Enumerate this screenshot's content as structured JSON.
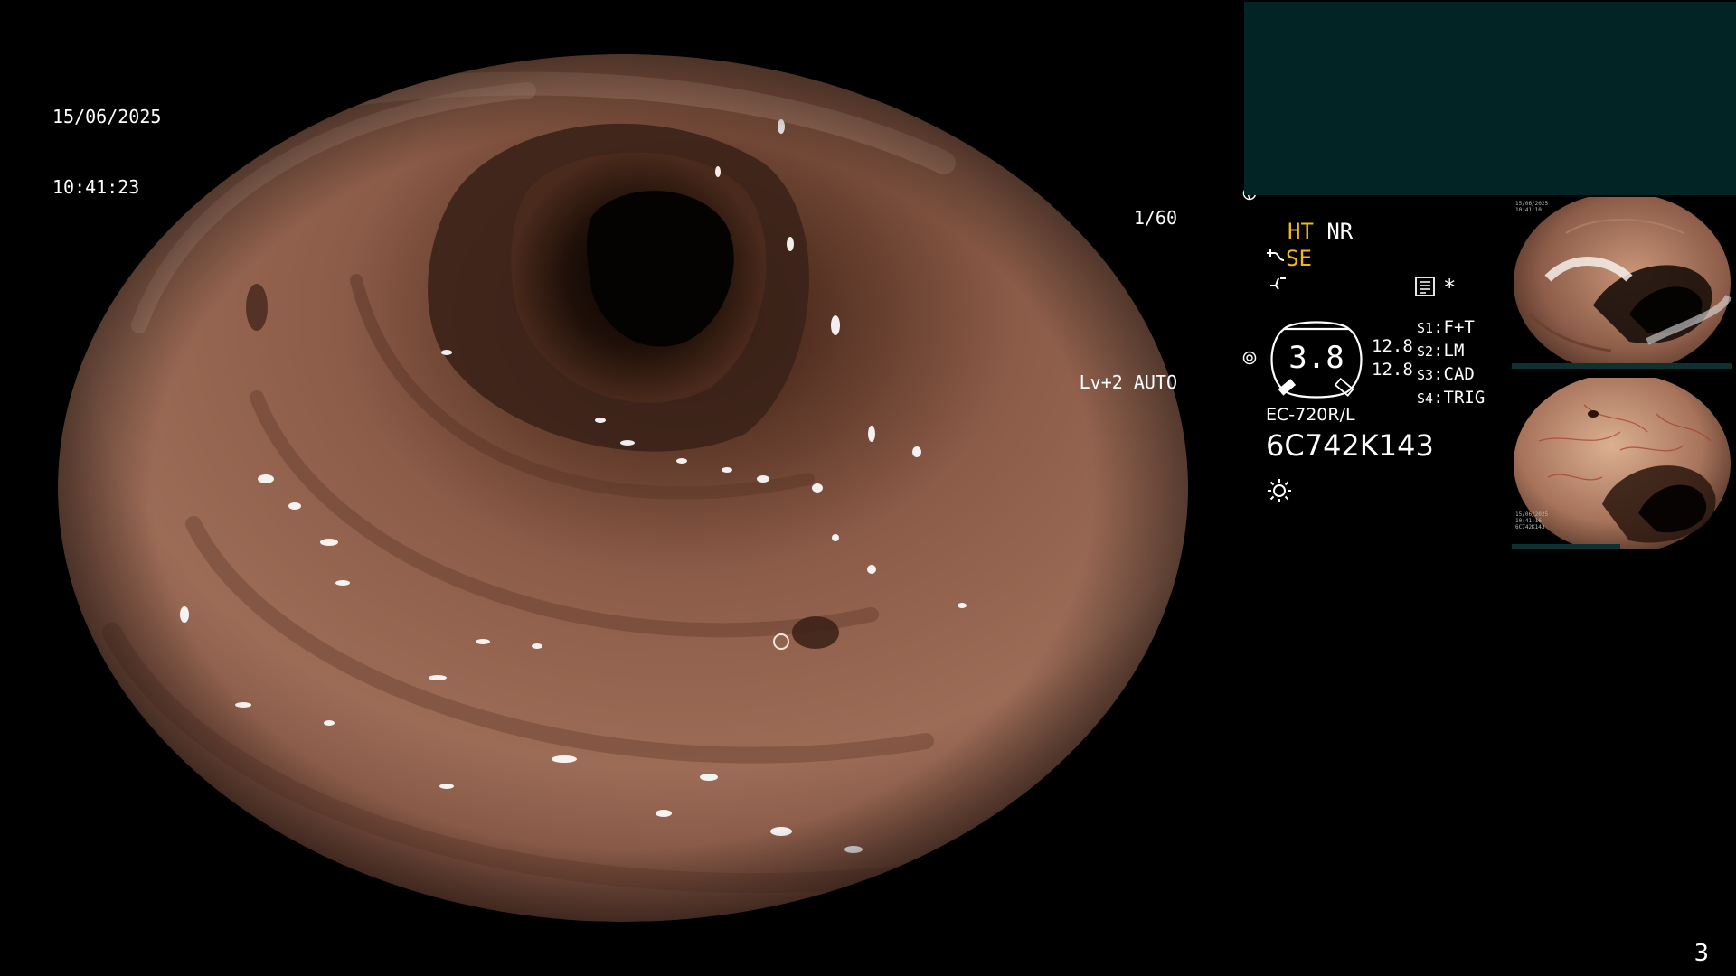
{
  "datetime": {
    "date": "15/06/2025",
    "time": "10:41:23"
  },
  "exposure": {
    "shutter": "1/60",
    "level": "Lv+2 AUTO"
  },
  "icons": {
    "shutter": "aperture-icon",
    "auto": "iris-icon",
    "scope_curve": "scope-bend-icon",
    "lightning": "flash-icon",
    "record": "record-icon",
    "asterisk": "asterisk-icon",
    "light": "light-source-icon"
  },
  "modes": {
    "ht": "HT",
    "nr": "NR",
    "se": "SE",
    "record_mark": "*"
  },
  "gauge": {
    "value": "3.8",
    "readout_1": "12.8",
    "readout_2": "12.8"
  },
  "switches": [
    {
      "key": "S1",
      "label": "F+T"
    },
    {
      "key": "S2",
      "label": "LM"
    },
    {
      "key": "S3",
      "label": "CAD"
    },
    {
      "key": "S4",
      "label": "TRIG"
    }
  ],
  "scope": {
    "model": "EC-720R/L",
    "serial": "6C742K143"
  },
  "thumbnails": [
    {
      "date": "15/06/2025",
      "time": "10:41:10",
      "serial": ""
    },
    {
      "date": "15/06/2025",
      "time": "10:41:16",
      "serial": "6C742K143"
    }
  ],
  "page_number": "3",
  "colors": {
    "accent_yellow": "#f1b81a",
    "panel_teal": "#032424",
    "background": "#000000"
  }
}
